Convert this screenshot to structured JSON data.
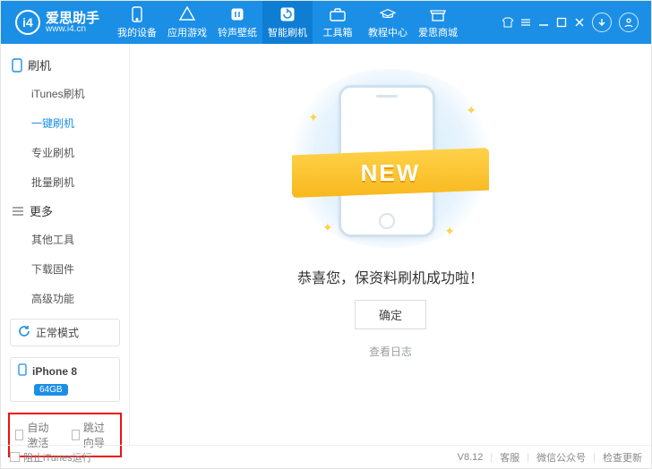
{
  "brand": {
    "name": "爱思助手",
    "url": "www.i4.cn",
    "badge": "i4"
  },
  "top_tabs": [
    {
      "label": "我的设备"
    },
    {
      "label": "应用游戏"
    },
    {
      "label": "铃声壁纸"
    },
    {
      "label": "智能刷机"
    },
    {
      "label": "工具箱"
    },
    {
      "label": "教程中心"
    },
    {
      "label": "爱思商城"
    }
  ],
  "active_tab_index": 3,
  "sidebar": {
    "group1": {
      "title": "刷机",
      "items": [
        "iTunes刷机",
        "一键刷机",
        "专业刷机",
        "批量刷机"
      ],
      "active_index": 1
    },
    "group2": {
      "title": "更多",
      "items": [
        "其他工具",
        "下载固件",
        "高级功能"
      ]
    }
  },
  "mode": {
    "label": "正常模式"
  },
  "device": {
    "name": "iPhone 8",
    "storage": "64GB"
  },
  "bottom_checks": {
    "auto_activate": "自动激活",
    "skip_wizard": "跳过向导"
  },
  "main": {
    "ribbon": "NEW",
    "message": "恭喜您，保资料刷机成功啦！",
    "ok": "确定",
    "log": "查看日志"
  },
  "status": {
    "block_itunes": "阻止iTunes运行",
    "version": "V8.12",
    "cs": "客服",
    "wechat": "微信公众号",
    "update": "检查更新"
  }
}
